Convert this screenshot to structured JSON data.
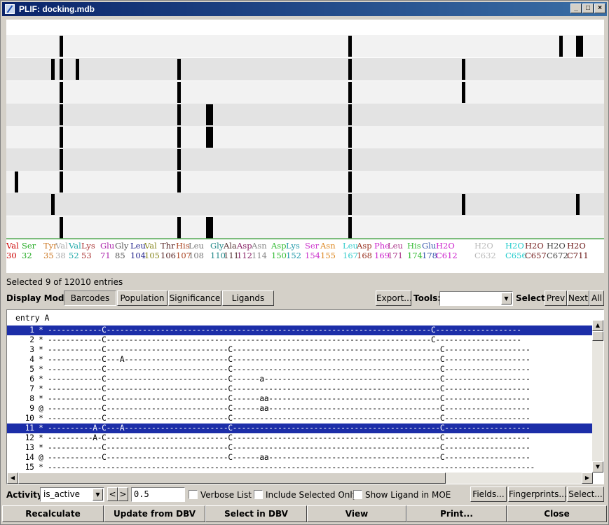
{
  "window": {
    "title": "PLIF: docking.mdb",
    "controls": [
      "minimize-icon",
      "maximize-icon",
      "close-icon"
    ]
  },
  "residues": [
    {
      "name": "Val",
      "num": "30",
      "color": "#cc0000"
    },
    {
      "name": "Ser",
      "num": "32",
      "color": "#22aa22"
    },
    {
      "name": "Tyr",
      "num": "35",
      "color": "#cc7722"
    },
    {
      "name": "Val",
      "num": "38",
      "color": "#aaaaaa"
    },
    {
      "name": "Val",
      "num": "52",
      "color": "#22aaaa"
    },
    {
      "name": "Lys",
      "num": "53",
      "color": "#aa3333"
    },
    {
      "name": "Glu",
      "num": "71",
      "color": "#aa22aa"
    },
    {
      "name": "Gly",
      "num": "85",
      "color": "#555555"
    },
    {
      "name": "Leu",
      "num": "104",
      "color": "#22228a"
    },
    {
      "name": "Val",
      "num": "105",
      "color": "#888822"
    },
    {
      "name": "Thr",
      "num": "106",
      "color": "#552222"
    },
    {
      "name": "His",
      "num": "107",
      "color": "#aa4422"
    },
    {
      "name": "Leu",
      "num": "108",
      "color": "#777777"
    },
    {
      "name": "Gly",
      "num": "110",
      "color": "#228888"
    },
    {
      "name": "Ala",
      "num": "111",
      "color": "#553333"
    },
    {
      "name": "Asp",
      "num": "112",
      "color": "#882266"
    },
    {
      "name": "Asn",
      "num": "114",
      "color": "#888888"
    },
    {
      "name": "Asp",
      "num": "150",
      "color": "#33bb33"
    },
    {
      "name": "Lys",
      "num": "152",
      "color": "#2299aa"
    },
    {
      "name": "Ser",
      "num": "154",
      "color": "#cc33cc"
    },
    {
      "name": "Asn",
      "num": "155",
      "color": "#dd8822"
    },
    {
      "name": "Leu",
      "num": "167",
      "color": "#33cccc"
    },
    {
      "name": "Asp",
      "num": "168",
      "color": "#993322"
    },
    {
      "name": "Phe",
      "num": "169",
      "color": "#cc22cc"
    },
    {
      "name": "Leu",
      "num": "171",
      "color": "#aa3388"
    },
    {
      "name": "His",
      "num": "174",
      "color": "#33bb33"
    },
    {
      "name": "Glu",
      "num": "178",
      "color": "#3355aa"
    },
    {
      "name": "H2O",
      "num": "C612",
      "color": "#cc22cc"
    },
    {
      "name": "H2O",
      "num": "C632",
      "color": "#bbbbbb"
    },
    {
      "name": "H2O",
      "num": "C656",
      "color": "#22cccc"
    },
    {
      "name": "H2O",
      "num": "C657",
      "color": "#772222"
    },
    {
      "name": "H2O",
      "num": "C672",
      "color": "#444444"
    },
    {
      "name": "H2O",
      "num": "C711",
      "color": "#661111"
    }
  ],
  "status": "Selected 9 of 12010 entries",
  "display_mode": {
    "label": "Display Mode:",
    "tabs": [
      "Barcodes",
      "Population",
      "Significance",
      "Ligands"
    ],
    "selected": "Barcodes"
  },
  "export_label": "Export...",
  "tools_label": "Tools:",
  "tools_value": "",
  "select_label": "Select:",
  "nav": {
    "prev": "Prev",
    "next": "Next",
    "all": "All"
  },
  "list": {
    "header": "entry A",
    "rows": [
      {
        "n": "1",
        "m": "*",
        "pat": "------------C------------------------------------------------------------------------C-------------------",
        "sel": true
      },
      {
        "n": "2",
        "m": "*",
        "pat": "------------C------------------------------------------------------------------------C-------------------",
        "sel": false
      },
      {
        "n": "3",
        "m": "*",
        "pat": "------------C---------------------------C----------------------------------------------C-------------------",
        "sel": false
      },
      {
        "n": "4",
        "m": "*",
        "pat": "------------C---A-----------------------C----------------------------------------------C-------------------",
        "sel": false
      },
      {
        "n": "5",
        "m": "*",
        "pat": "------------C---------------------------C----------------------------------------------C-------------------",
        "sel": false
      },
      {
        "n": "6",
        "m": "*",
        "pat": "------------C---------------------------C------a---------------------------------------C-------------------",
        "sel": false
      },
      {
        "n": "7",
        "m": "*",
        "pat": "------------C---------------------------C----------------------------------------------C-------------------",
        "sel": false
      },
      {
        "n": "8",
        "m": "*",
        "pat": "------------C---------------------------C------aa--------------------------------------C-------------------",
        "sel": false
      },
      {
        "n": "9",
        "m": "@",
        "pat": "------------C---------------------------C------aa--------------------------------------C-------------------",
        "sel": false
      },
      {
        "n": "10",
        "m": "*",
        "pat": "------------C---------------------------C----------------------------------------------C-------------------",
        "sel": false
      },
      {
        "n": "11",
        "m": "*",
        "pat": "----------A-C---A-----------------------C----------------------------------------------C-------------------",
        "sel": true
      },
      {
        "n": "12",
        "m": "*",
        "pat": "----------A-C---------------------------C----------------------------------------------C-------------------",
        "sel": false
      },
      {
        "n": "13",
        "m": "*",
        "pat": "------------C---------------------------C----------------------------------------------C-------------------",
        "sel": false
      },
      {
        "n": "14",
        "m": "@",
        "pat": "------------C---------------------------C------aa--------------------------------------C-------------------",
        "sel": false
      },
      {
        "n": "15",
        "m": "*",
        "pat": "------------------------------------------------------------------------------------------------------------",
        "sel": false
      }
    ]
  },
  "activity": {
    "label": "Activity:",
    "value": "is_active",
    "lt": "<",
    "gt": ">",
    "threshold": "0.5",
    "verbose": "Verbose List",
    "include_selected": "Include Selected Only",
    "show_ligand": "Show Ligand in MOE",
    "fields": "Fields...",
    "fingerprints": "Fingerprints...",
    "select": "Select..."
  },
  "buttons": {
    "recalculate": "Recalculate",
    "update": "Update from DBV",
    "select_dbv": "Select in DBV",
    "view": "View",
    "print": "Print...",
    "close": "Close"
  }
}
